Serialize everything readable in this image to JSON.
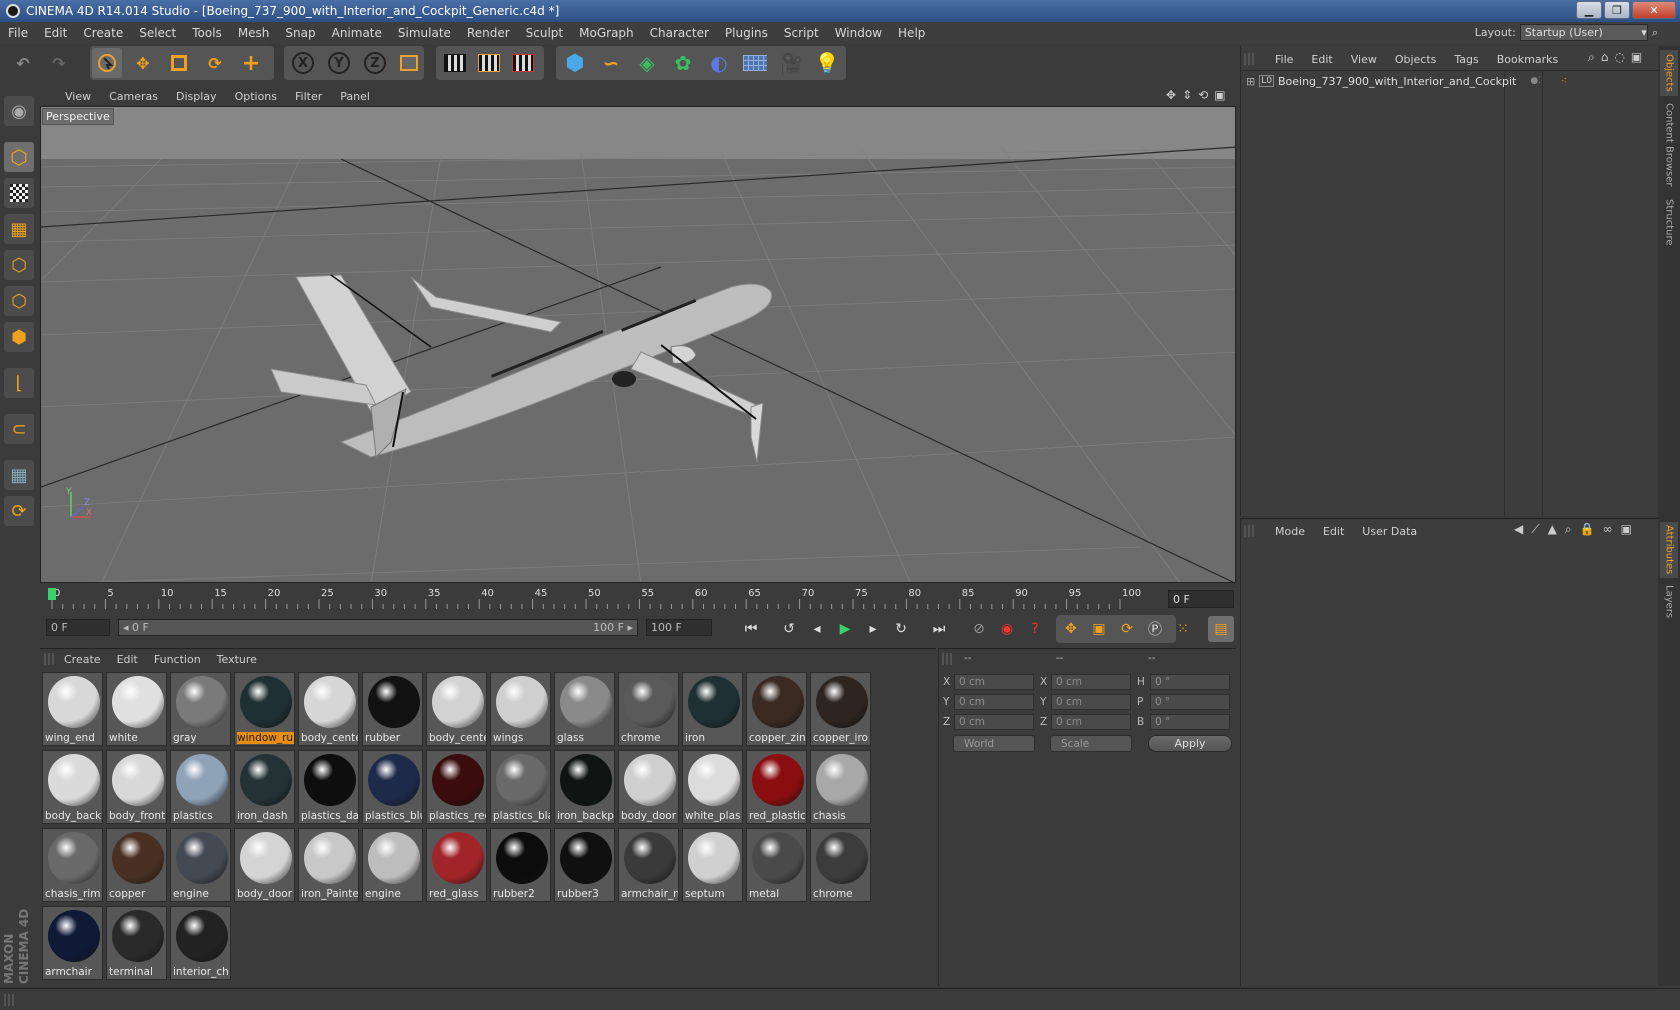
{
  "window": {
    "title": "CINEMA 4D R14.014 Studio - [Boeing_737_900_with_Interior_and_Cockpit_Generic.c4d *]",
    "minimize": "▁",
    "maximize": "❐",
    "close": "✕"
  },
  "menubar": [
    "File",
    "Edit",
    "Create",
    "Select",
    "Tools",
    "Mesh",
    "Snap",
    "Animate",
    "Simulate",
    "Render",
    "Sculpt",
    "MoGraph",
    "Character",
    "Plugins",
    "Script",
    "Window",
    "Help"
  ],
  "layout": {
    "label": "Layout:",
    "value": "Startup (User)"
  },
  "toolbar": {
    "axis_x": "X",
    "axis_y": "Y",
    "axis_z": "Z"
  },
  "viewport": {
    "menu": [
      "View",
      "Cameras",
      "Display",
      "Options",
      "Filter",
      "Panel"
    ],
    "label": "Perspective",
    "axis_x": "X",
    "axis_y": "Y",
    "axis_z": "Z"
  },
  "timeline": {
    "ticks": [
      "0",
      "5",
      "10",
      "15",
      "20",
      "25",
      "30",
      "35",
      "40",
      "45",
      "50",
      "55",
      "60",
      "65",
      "70",
      "75",
      "80",
      "85",
      "90",
      "95",
      "100"
    ],
    "current_frame": "0 F",
    "start_field": "0 F",
    "range_start": "◂ 0 F",
    "range_end": "100 F ▸",
    "end_field": "100 F"
  },
  "materials": {
    "menu": [
      "Create",
      "Edit",
      "Function",
      "Texture"
    ],
    "items": [
      {
        "name": "wing_end",
        "color": "#d8d8d8"
      },
      {
        "name": "white",
        "color": "#e0e0e0"
      },
      {
        "name": "gray",
        "color": "#7a7a7a"
      },
      {
        "name": "window_ru",
        "color": "#1f3034",
        "selected": true
      },
      {
        "name": "body_cente",
        "color": "#d6d6d6"
      },
      {
        "name": "rubber",
        "color": "#121212"
      },
      {
        "name": "body_cente",
        "color": "#d2d2d2"
      },
      {
        "name": "wings",
        "color": "#cfcfcf"
      },
      {
        "name": "glass",
        "color": "#8a8a8a"
      },
      {
        "name": "chrome",
        "color": "#5a5a5a"
      },
      {
        "name": "iron",
        "color": "#1e3034"
      },
      {
        "name": "copper_zin",
        "color": "#3a2a22"
      },
      {
        "name": "copper_iro",
        "color": "#2e2420"
      },
      {
        "name": "body_back",
        "color": "#dadada"
      },
      {
        "name": "body_front",
        "color": "#d8d8d8"
      },
      {
        "name": "plastics",
        "color": "#8ea2b8"
      },
      {
        "name": "iron_dash",
        "color": "#243236"
      },
      {
        "name": "plastics_da",
        "color": "#0e0e0e"
      },
      {
        "name": "plastics_blu",
        "color": "#1e2a4a"
      },
      {
        "name": "plastics_rec",
        "color": "#3a0c0e"
      },
      {
        "name": "plastics_bla",
        "color": "#6a6a6a"
      },
      {
        "name": "iron_backp",
        "color": "#101514"
      },
      {
        "name": "body_door",
        "color": "#cfcfcf"
      },
      {
        "name": "white_plas",
        "color": "#dcdcdc"
      },
      {
        "name": "red_plastic",
        "color": "#8a0e10"
      },
      {
        "name": "chasis",
        "color": "#a8a8a8"
      },
      {
        "name": "chasis_rim",
        "color": "#6a6a6a"
      },
      {
        "name": "copper",
        "color": "#4a3022"
      },
      {
        "name": "engine",
        "color": "#444a54"
      },
      {
        "name": "body_door",
        "color": "#d4d4d4"
      },
      {
        "name": "iron_Painte",
        "color": "#c8c8c8"
      },
      {
        "name": "engine",
        "color": "#bdbdbd"
      },
      {
        "name": "red_glass",
        "color": "#a02428"
      },
      {
        "name": "rubber2",
        "color": "#0c0c0c"
      },
      {
        "name": "rubber3",
        "color": "#101010"
      },
      {
        "name": "armchair_m",
        "color": "#3a3a3a"
      },
      {
        "name": "septum",
        "color": "#d0d0d0"
      },
      {
        "name": "metal",
        "color": "#4a4a4a"
      },
      {
        "name": "chrome",
        "color": "#3c3c3c"
      },
      {
        "name": "armchair",
        "color": "#0e1a36"
      },
      {
        "name": "terminal",
        "color": "#2a2a2a"
      },
      {
        "name": "interior_ch",
        "color": "#222222"
      }
    ]
  },
  "coordinates": {
    "headers": [
      "--",
      "--",
      "--"
    ],
    "rows": [
      {
        "l1": "X",
        "v1": "0 cm",
        "l2": "X",
        "v2": "0 cm",
        "l3": "H",
        "v3": "0 °"
      },
      {
        "l1": "Y",
        "v1": "0 cm",
        "l2": "Y",
        "v2": "0 cm",
        "l3": "P",
        "v3": "0 °"
      },
      {
        "l1": "Z",
        "v1": "0 cm",
        "l2": "Z",
        "v2": "0 cm",
        "l3": "B",
        "v3": "0 °"
      }
    ],
    "world": "World",
    "scale": "Scale",
    "apply": "Apply"
  },
  "objects": {
    "menu": [
      "File",
      "Edit",
      "View",
      "Objects",
      "Tags",
      "Bookmarks"
    ],
    "items": [
      {
        "name": "Boeing_737_900_with_Interior_and_Cockpit",
        "icon": "L0"
      }
    ]
  },
  "attributes": {
    "menu": [
      "Mode",
      "Edit",
      "User Data"
    ]
  },
  "sidetabs": [
    "Objects",
    "Content Browser",
    "Structure",
    "Attributes",
    "Layers"
  ],
  "logo": {
    "line1": "MAXON",
    "line2": "CINEMA 4D"
  }
}
